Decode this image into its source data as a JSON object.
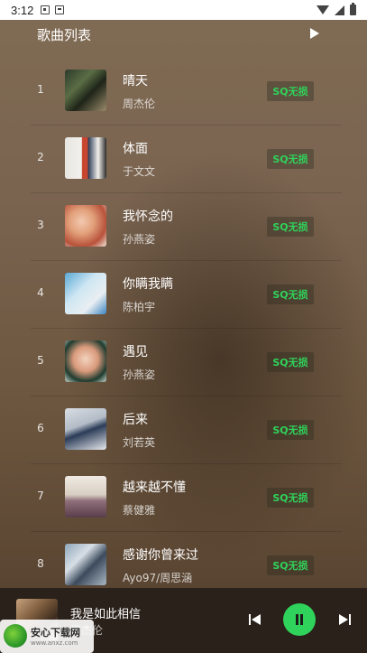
{
  "status_bar": {
    "time": "3:12"
  },
  "header": {
    "title": "歌曲列表",
    "play_icon": "play-icon"
  },
  "songs": [
    {
      "index": "1",
      "title": "晴天",
      "artist": "周杰伦",
      "badge": "SQ无损"
    },
    {
      "index": "2",
      "title": "体面",
      "artist": "于文文",
      "badge": "SQ无损"
    },
    {
      "index": "3",
      "title": "我怀念的",
      "artist": "孙燕姿",
      "badge": "SQ无损"
    },
    {
      "index": "4",
      "title": "你瞒我瞒",
      "artist": "陈柏宇",
      "badge": "SQ无损"
    },
    {
      "index": "5",
      "title": "遇见",
      "artist": "孙燕姿",
      "badge": "SQ无损"
    },
    {
      "index": "6",
      "title": "后来",
      "artist": "刘若英",
      "badge": "SQ无损"
    },
    {
      "index": "7",
      "title": "越来越不懂",
      "artist": "蔡健雅",
      "badge": "SQ无损"
    },
    {
      "index": "8",
      "title": "感谢你曾来过",
      "artist": "Ayo97/周思涵",
      "badge": "SQ无损"
    }
  ],
  "player": {
    "title": "我是如此相信",
    "artist": "周杰伦"
  },
  "watermark": {
    "name": "安心下载网",
    "url": "www.anxz.com"
  },
  "colors": {
    "badge_green": "#2fd25a",
    "play_button": "#2fd25a"
  }
}
